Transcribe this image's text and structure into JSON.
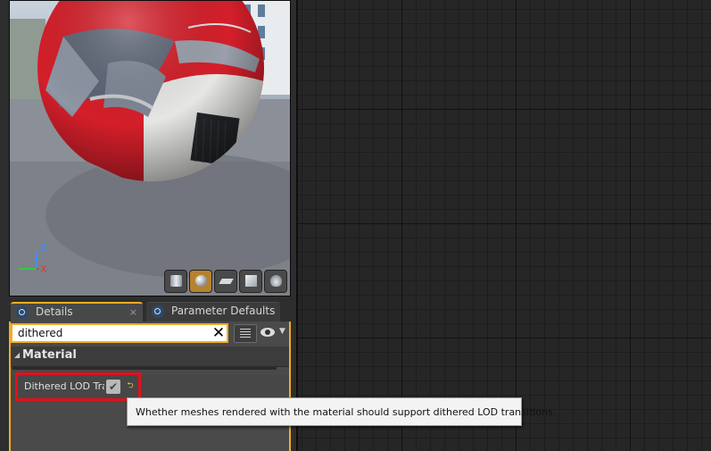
{
  "viewport": {
    "axes": {
      "z_label": "Z",
      "x_label": "X"
    },
    "toolbar": [
      {
        "name": "cylinder-icon",
        "active": false
      },
      {
        "name": "sphere-icon",
        "active": true
      },
      {
        "name": "plane-icon",
        "active": false
      },
      {
        "name": "cube-icon",
        "active": false
      },
      {
        "name": "teapot-icon",
        "active": false
      }
    ]
  },
  "tabs": [
    {
      "label": "Details",
      "icon": "search-icon",
      "close": "×",
      "active": true
    },
    {
      "label": "Parameter Defaults",
      "icon": "search-icon",
      "close": "",
      "active": false
    }
  ],
  "search": {
    "value": "dithered",
    "clear_glyph": "✕"
  },
  "category": {
    "label": "Material",
    "expanded": true
  },
  "property": {
    "name": "Dithered LOD Transition",
    "checked": true,
    "reset_icon": "reset-arrow-icon"
  },
  "tooltip": {
    "text": "Whether meshes rendered with the material should support dithered LOD transitions."
  },
  "colors": {
    "accent": "#f0ad27",
    "highlight": "#e4101b",
    "sphere_red": "#d41f2a",
    "graph_bg": "#262626"
  }
}
